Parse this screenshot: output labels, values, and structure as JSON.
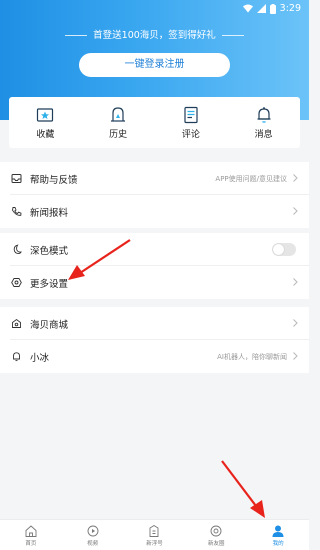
{
  "status_bar": {
    "time": "3:29"
  },
  "header": {
    "promo": "首登送100海贝，签到得好礼",
    "login_button": "一键登录注册"
  },
  "quick_actions": [
    {
      "label": "收藏",
      "icon": "star-folder-icon"
    },
    {
      "label": "历史",
      "icon": "history-icon"
    },
    {
      "label": "评论",
      "icon": "comment-icon"
    },
    {
      "label": "消息",
      "icon": "bell-icon"
    }
  ],
  "settings": {
    "help": {
      "label": "帮助与反馈",
      "hint": "APP使用问题/意见建议"
    },
    "news_tip": {
      "label": "新闻报料"
    },
    "dark_mode": {
      "label": "深色模式",
      "enabled": false
    },
    "more_settings": {
      "label": "更多设置"
    },
    "shop": {
      "label": "海贝商城"
    },
    "xiaobing": {
      "label": "小冰",
      "hint": "AI机器人，陪你聊新闻"
    }
  },
  "tabbar": [
    {
      "label": "首页",
      "icon": "home-icon",
      "active": false
    },
    {
      "label": "视频",
      "icon": "video-icon",
      "active": false
    },
    {
      "label": "新浮号",
      "icon": "media-icon",
      "active": false
    },
    {
      "label": "新友圈",
      "icon": "community-icon",
      "active": false
    },
    {
      "label": "我的",
      "icon": "profile-icon",
      "active": true
    }
  ],
  "colors": {
    "accent": "#1e8fe4",
    "annotation_arrow": "#e8231c"
  }
}
